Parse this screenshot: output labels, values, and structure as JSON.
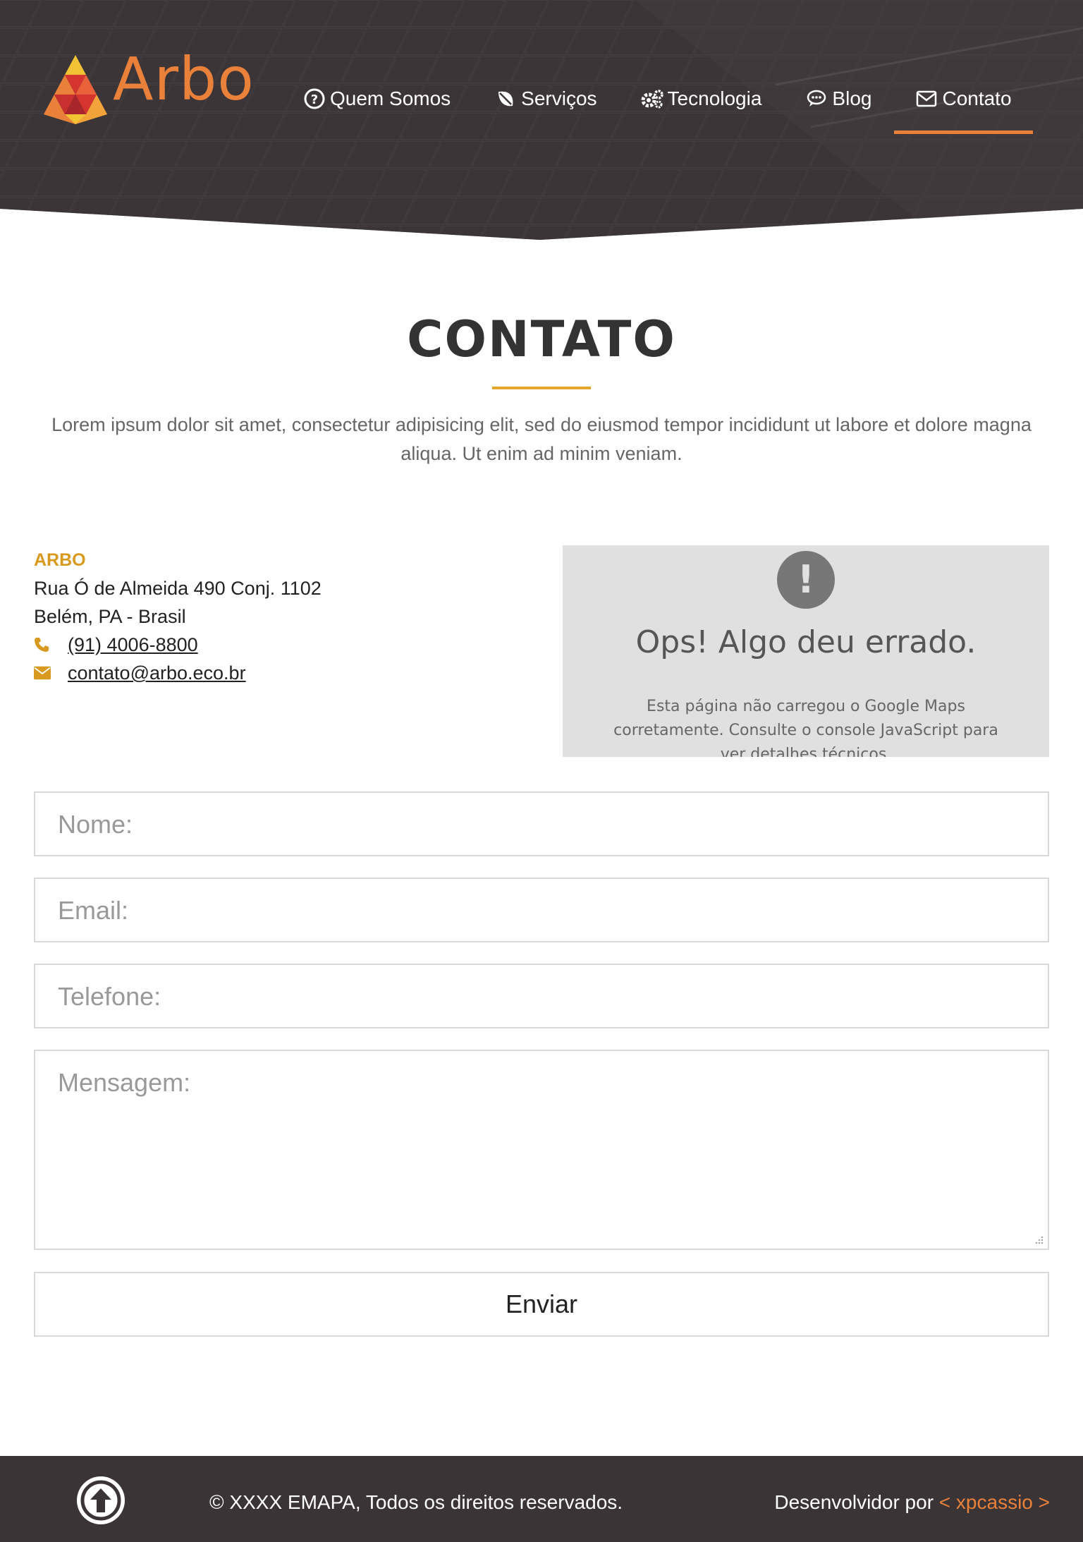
{
  "header": {
    "logo_text": "Arbo",
    "nav": [
      {
        "label": "Quem Somos",
        "icon": "question-circle-icon"
      },
      {
        "label": "Serviços",
        "icon": "leaf-icon"
      },
      {
        "label": "Tecnologia",
        "icon": "gears-icon"
      },
      {
        "label": "Blog",
        "icon": "comment-icon"
      },
      {
        "label": "Contato",
        "icon": "envelope-icon",
        "active": true
      }
    ]
  },
  "main": {
    "title": "CONTATO",
    "intro": "Lorem ipsum dolor sit amet, consectetur adipisicing elit, sed do eiusmod tempor incididunt ut labore et dolore magna aliqua. Ut enim ad minim veniam."
  },
  "contact": {
    "company": "ARBO",
    "address_line1": "Rua Ó de Almeida 490 Conj. 1102",
    "address_line2": "Belém, PA - Brasil",
    "phone": "(91) 4006-8800",
    "email": "contato@arbo.eco.br"
  },
  "map_error": {
    "icon": "exclamation-icon",
    "title": "Ops! Algo deu errado.",
    "text": "Esta página não carregou o Google Maps corretamente. Consulte o console JavaScript para ver detalhes técnicos."
  },
  "form": {
    "name_placeholder": "Nome:",
    "email_placeholder": "Email:",
    "phone_placeholder": "Telefone:",
    "message_placeholder": "Mensagem:",
    "submit_label": "Enviar"
  },
  "footer": {
    "copyright": "© XXXX EMAPA, Todos os direitos reservados.",
    "dev_prefix": "Desenvolvidor por ",
    "dev_link": "< xpcassio >"
  },
  "colors": {
    "accent": "#e9813a",
    "gold": "#e5a72b",
    "header_bg": "#3a3436"
  }
}
